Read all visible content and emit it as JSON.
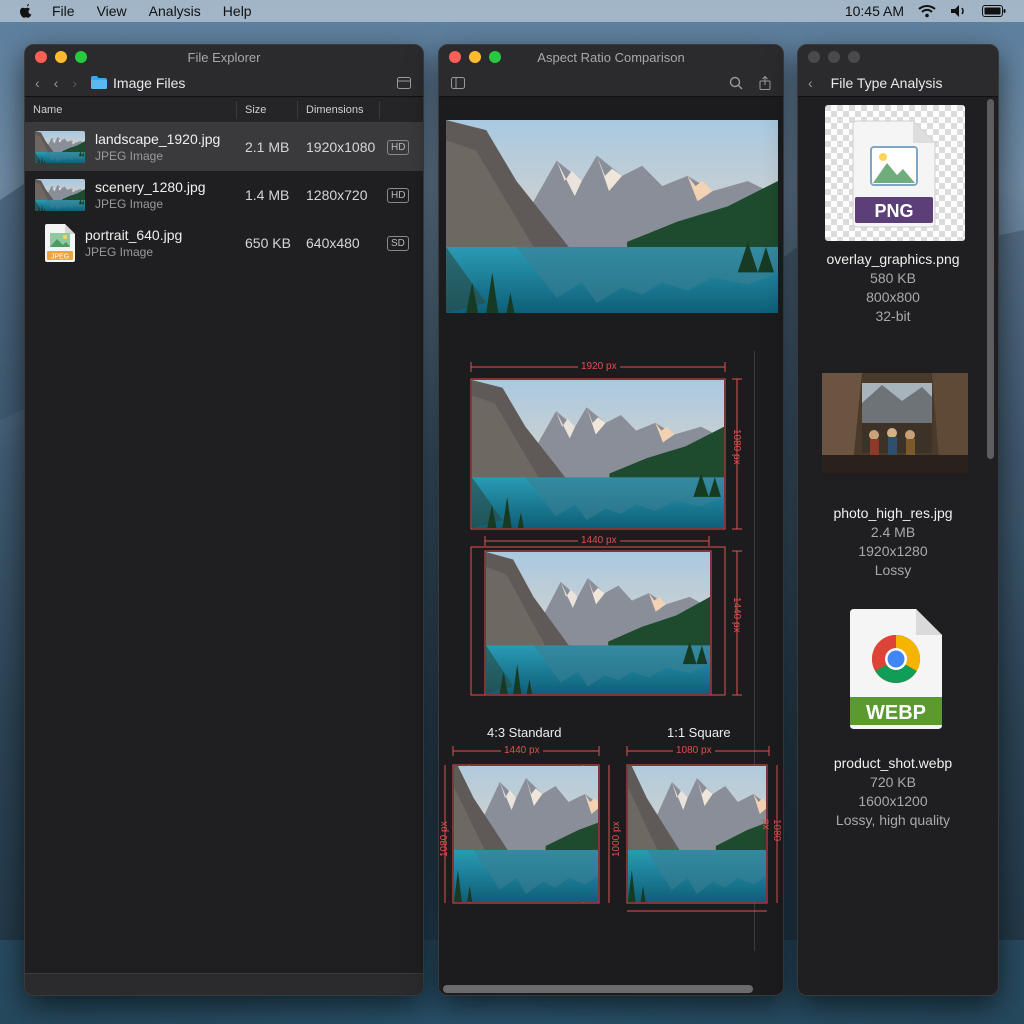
{
  "menubar": {
    "items": [
      "File",
      "View",
      "Analysis",
      "Help"
    ],
    "clock": "10:45 AM"
  },
  "file_explorer": {
    "title": "File Explorer",
    "folder": "Image Files",
    "columns": [
      "Name",
      "Size",
      "Dimensions"
    ],
    "rows": [
      {
        "name": "landscape_1920.jpg",
        "type": "JPEG Image",
        "size": "2.1 MB",
        "dimensions": "1920x1080",
        "badge": "HD"
      },
      {
        "name": "scenery_1280.jpg",
        "type": "JPEG Image",
        "size": "1.4 MB",
        "dimensions": "1280x720",
        "badge": "HD"
      },
      {
        "name": "portrait_640.jpg",
        "type": "JPEG Image",
        "size": "650 KB",
        "dimensions": "640x480",
        "badge": "SD"
      }
    ],
    "jpeg_icon_label": "JPEG"
  },
  "comparison": {
    "title": "Aspect Ratio Comparison",
    "dims": {
      "w1920": "1920 px",
      "h1080": "1080 px",
      "w1440": "1440 px",
      "h1440": "1440 px",
      "w1440b": "1440 px",
      "h1080b": "1080 px",
      "w1080": "1080 px",
      "h1080c": "1000 px",
      "h1080d": "1080 px"
    },
    "labels": {
      "standard": "4:3 Standard",
      "square": "1:1 Square"
    }
  },
  "analysis": {
    "title": "File Type Analysis",
    "cards": [
      {
        "icon_label": "PNG",
        "name": "overlay_graphics.png",
        "lines": [
          "580 KB",
          "800x800",
          "32-bit"
        ]
      },
      {
        "name": "photo_high_res.jpg",
        "lines": [
          "2.4 MB",
          "1920x1280",
          "Lossy"
        ]
      },
      {
        "icon_label": "WEBP",
        "name": "product_shot.webp",
        "lines": [
          "720 KB",
          "1600x1200",
          "Lossy, high quality"
        ]
      }
    ]
  },
  "colors": {
    "accent_red": "#e05050",
    "png_badge": "#5c3f78",
    "webp_badge": "#5a9a2e"
  }
}
